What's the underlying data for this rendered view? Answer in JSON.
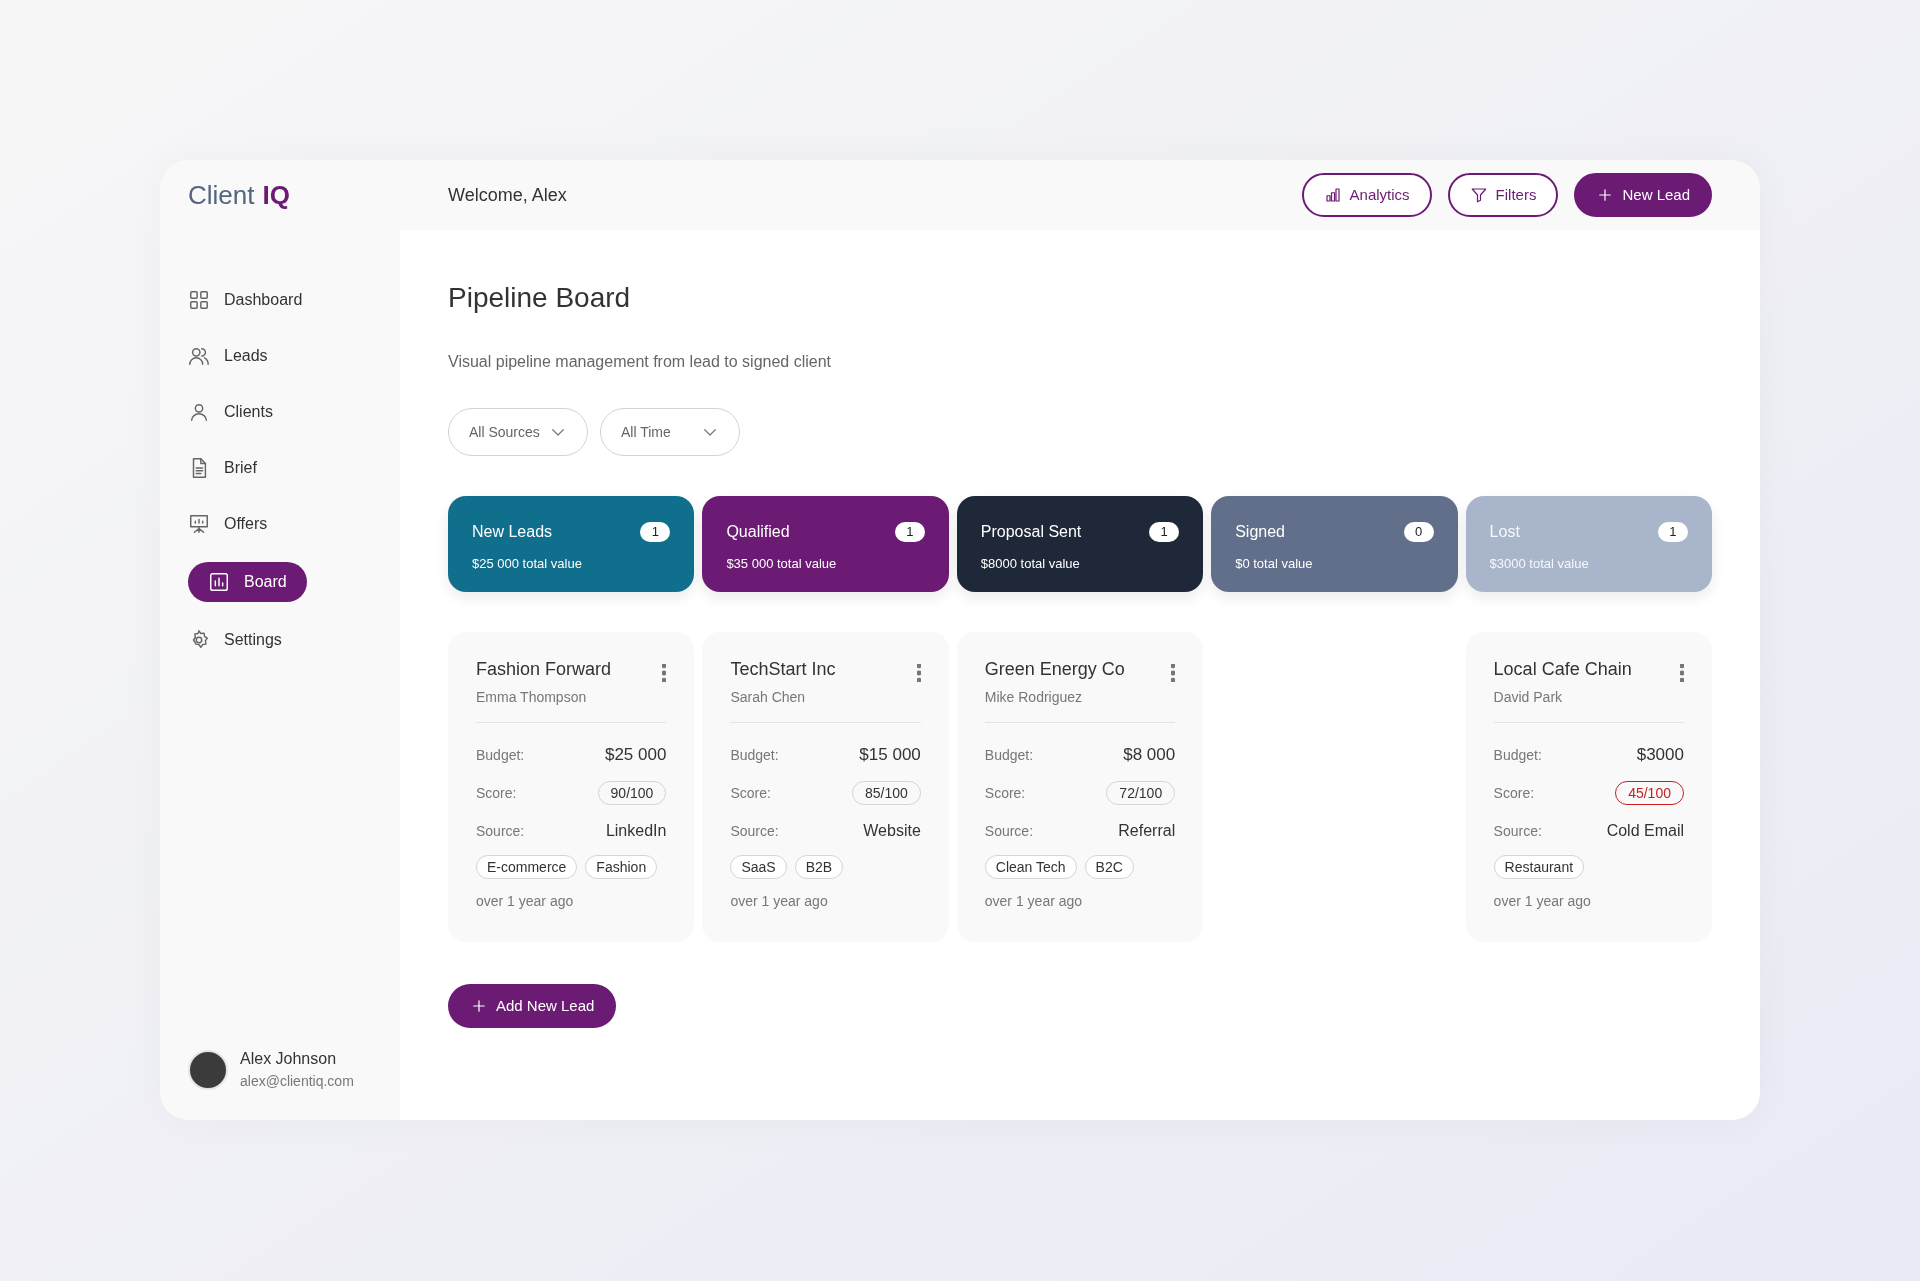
{
  "logo": {
    "first": "Client",
    "second": "IQ"
  },
  "header": {
    "welcome": "Welcome, Alex",
    "buttons": [
      {
        "label": "Analytics",
        "kind": "outline"
      },
      {
        "label": "Filters",
        "kind": "outline"
      },
      {
        "label": "New Lead",
        "kind": "primary"
      }
    ]
  },
  "sidebar": {
    "items": [
      {
        "label": "Dashboard",
        "selected": false
      },
      {
        "label": "Leads",
        "selected": false
      },
      {
        "label": "Clients",
        "selected": false
      },
      {
        "label": "Brief",
        "selected": false
      },
      {
        "label": "Offers",
        "selected": false
      },
      {
        "label": "Board",
        "selected": true
      },
      {
        "label": "Settings",
        "selected": false
      }
    ],
    "user": {
      "name": "Alex Johnson",
      "email": "alex@clientiq.com"
    }
  },
  "page": {
    "title": "Pipeline Board",
    "subtitle": "Visual pipeline management from lead to signed client",
    "filters": [
      "All Sources",
      "All Time"
    ]
  },
  "stages": [
    {
      "name": "New Leads",
      "count": "1",
      "total": "$25 000 total value",
      "color": "#106f8d",
      "muted": false,
      "leads": [
        {
          "company": "Fashion Forward",
          "contact": "Emma Thompson",
          "budget_label": "Budget:",
          "budget": "$25 000",
          "score_label": "Score:",
          "score": "90/100",
          "score_low": false,
          "source_label": "Source:",
          "source": "LinkedIn",
          "tags": [
            "E-commerce",
            "Fashion"
          ],
          "age": "over 1 year ago"
        }
      ]
    },
    {
      "name": "Qualified",
      "count": "1",
      "total": "$35 000 total value",
      "color": "#6b1b73",
      "muted": false,
      "leads": [
        {
          "company": "TechStart Inc",
          "contact": "Sarah Chen",
          "budget_label": "Budget:",
          "budget": "$15 000",
          "score_label": "Score:",
          "score": "85/100",
          "score_low": false,
          "source_label": "Source:",
          "source": "Website",
          "tags": [
            "SaaS",
            "B2B"
          ],
          "age": "over 1 year ago"
        }
      ]
    },
    {
      "name": "Proposal Sent",
      "count": "1",
      "total": "$8000 total value",
      "color": "#1f2838",
      "muted": false,
      "leads": [
        {
          "company": "Green Energy Co",
          "contact": "Mike Rodriguez",
          "budget_label": "Budget:",
          "budget": "$8 000",
          "score_label": "Score:",
          "score": "72/100",
          "score_low": false,
          "source_label": "Source:",
          "source": "Referral",
          "tags": [
            "Clean Tech",
            "B2C"
          ],
          "age": "over 1 year ago"
        }
      ]
    },
    {
      "name": "Signed",
      "count": "0",
      "total": "$0 total value",
      "color": "#616f8b",
      "muted": false
    },
    {
      "name": "Lost",
      "count": "1",
      "total": "$3000 total value",
      "color": "#a9b5cb",
      "muted": true,
      "leads": [
        {
          "company": "Local Cafe Chain",
          "contact": "David Park",
          "budget_label": "Budget:",
          "budget": "$3000",
          "score_label": "Score:",
          "score": "45/100",
          "score_low": true,
          "source_label": "Source:",
          "source": "Cold Email",
          "tags": [
            "Restaurant"
          ],
          "age": "over 1 year ago"
        }
      ]
    }
  ],
  "add_button": "Add New Lead"
}
